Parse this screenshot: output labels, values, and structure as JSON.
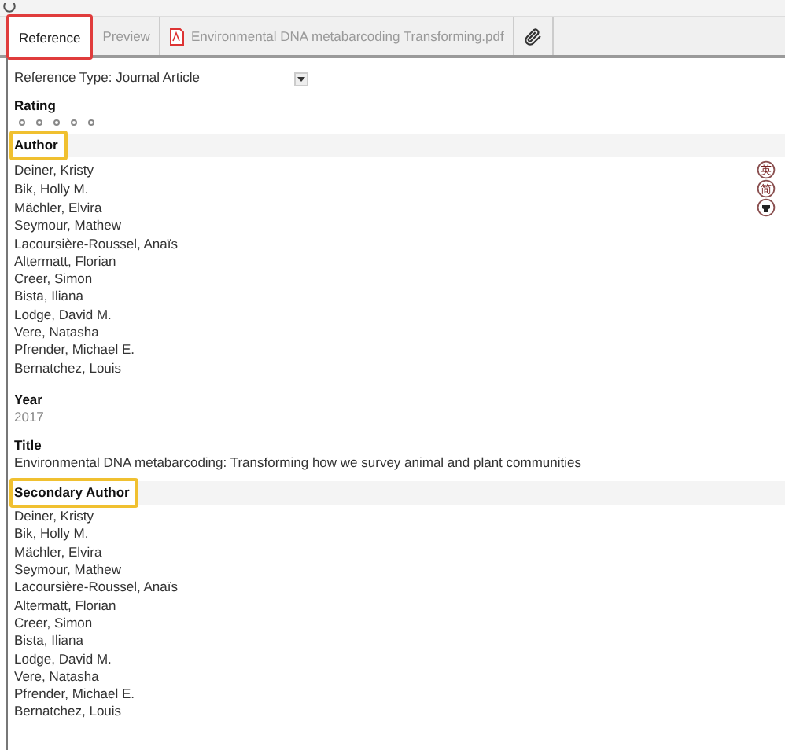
{
  "tabs": [
    {
      "label": "Reference",
      "selected": true,
      "outlined": true,
      "kind": "text"
    },
    {
      "label": "Preview",
      "selected": false,
      "outlined": false,
      "kind": "text"
    },
    {
      "label": "Environmental DNA metabarcoding  Transforming.pdf",
      "selected": false,
      "outlined": false,
      "kind": "pdf"
    },
    {
      "selected": false,
      "outlined": false,
      "kind": "attach"
    }
  ],
  "reference_type": {
    "label": "Reference Type:",
    "value": "Journal Article"
  },
  "rating": {
    "label": "Rating",
    "stars": 0
  },
  "author": {
    "label": "Author",
    "outlined": true,
    "names": [
      "Deiner, Kristy",
      "Bik, Holly M.",
      "Mächler, Elvira",
      "Seymour, Mathew",
      "Lacoursière-Roussel, Anaïs",
      "Altermatt, Florian",
      "Creer, Simon",
      "Bista, Iliana",
      "Lodge, David M.",
      "Vere, Natasha",
      "Pfrender, Michael E.",
      "Bernatchez, Louis"
    ],
    "side_icons": [
      {
        "kind": "text",
        "glyph": "英"
      },
      {
        "kind": "text",
        "glyph": "简"
      },
      {
        "kind": "figure"
      }
    ]
  },
  "year": {
    "label": "Year",
    "value": "2017"
  },
  "title": {
    "label": "Title",
    "value": "Environmental DNA metabarcoding: Transforming how we survey animal and plant communities"
  },
  "secondary_author": {
    "label": "Secondary Author",
    "outlined": true,
    "names": [
      "Deiner, Kristy",
      "Bik, Holly M.",
      "Mächler, Elvira",
      "Seymour, Mathew",
      "Lacoursière-Roussel, Anaïs",
      "Altermatt, Florian",
      "Creer, Simon",
      "Bista, Iliana",
      "Lodge, David M.",
      "Vere, Natasha",
      "Pfrender, Michael E.",
      "Bernatchez, Louis"
    ]
  }
}
